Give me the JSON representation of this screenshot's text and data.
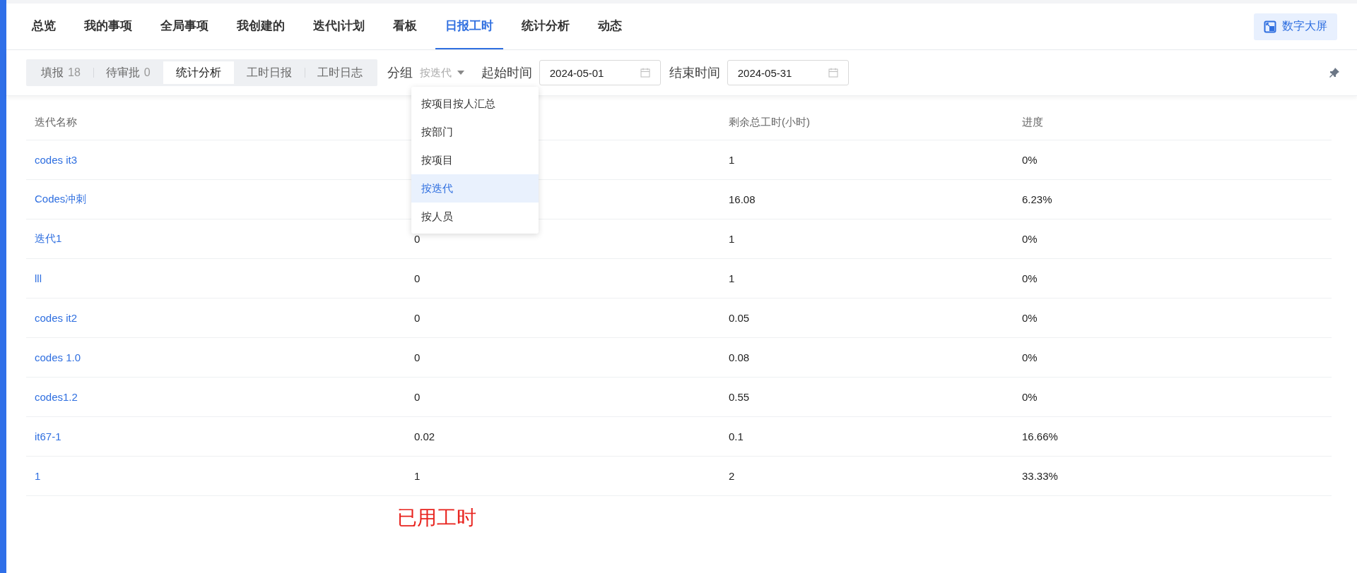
{
  "nav": {
    "tabs": [
      {
        "label": "总览",
        "selected": false
      },
      {
        "label": "我的事项",
        "selected": false
      },
      {
        "label": "全局事项",
        "selected": false
      },
      {
        "label": "我创建的",
        "selected": false
      },
      {
        "label": "迭代|计划",
        "selected": false
      },
      {
        "label": "看板",
        "selected": false
      },
      {
        "label": "日报工时",
        "selected": true
      },
      {
        "label": "统计分析",
        "selected": false
      },
      {
        "label": "动态",
        "selected": false
      }
    ],
    "screen_button": "数字大屏"
  },
  "toolbar": {
    "segments": [
      {
        "label": "填报",
        "count": "18",
        "selected": false
      },
      {
        "label": "待审批",
        "count": "0",
        "selected": false
      },
      {
        "label": "统计分析",
        "selected": true
      },
      {
        "label": "工时日报",
        "selected": false
      },
      {
        "label": "工时日志",
        "selected": false
      }
    ],
    "group_label": "分组",
    "group_value": "按迭代",
    "start_label": "起始时间",
    "start_date": "2024-05-01",
    "end_label": "结束时间",
    "end_date": "2024-05-31"
  },
  "group_menu": {
    "items": [
      {
        "label": "按项目按人汇总",
        "selected": false
      },
      {
        "label": "按部门",
        "selected": false
      },
      {
        "label": "按项目",
        "selected": false
      },
      {
        "label": "按迭代",
        "selected": true
      },
      {
        "label": "按人员",
        "selected": false
      }
    ]
  },
  "table": {
    "header": {
      "column_1": "迭代名称",
      "column_3": "剩余总工时(小时)",
      "column_4": "进度"
    },
    "rows": [
      {
        "column_1": "codes it3",
        "column_3": "1",
        "column_4": "0%"
      },
      {
        "column_1": "Codes冲刺",
        "column_3": "16.08",
        "column_4": "6.23%"
      },
      {
        "column_1": "迭代1",
        "column_2": "0",
        "column_3": "1",
        "column_4": "0%"
      },
      {
        "column_1": "lll",
        "column_2": "0",
        "column_3": "1",
        "column_4": "0%"
      },
      {
        "column_1": "codes it2",
        "column_2": "0",
        "column_3": "0.05",
        "column_4": "0%"
      },
      {
        "column_1": "codes 1.0",
        "column_2": "0",
        "column_3": "0.08",
        "column_4": "0%"
      },
      {
        "column_1": "codes1.2",
        "column_2": "0",
        "column_3": "0.55",
        "column_4": "0%"
      },
      {
        "column_1": "it67-1",
        "column_2": "0.02",
        "column_3": "0.1",
        "column_4": "16.66%"
      },
      {
        "column_1": "1",
        "column_2": "1",
        "column_3": "2",
        "column_4": "33.33%"
      }
    ]
  },
  "annotation": "已用工时"
}
